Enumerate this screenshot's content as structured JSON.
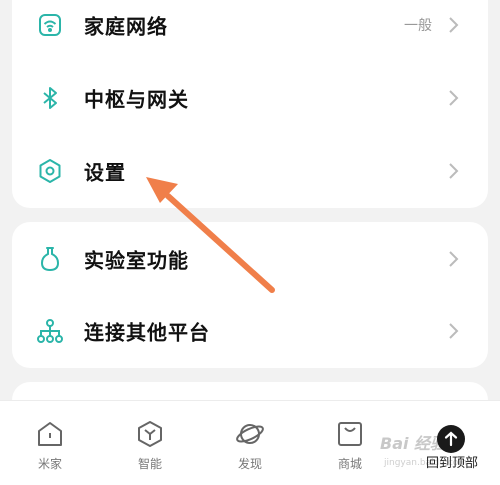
{
  "colors": {
    "accent": "#2bb5a9",
    "arrow": "#f07f4a",
    "background": "#f2f2f2",
    "card": "#ffffff"
  },
  "settings_group_1": {
    "items": [
      {
        "label": "家庭网络",
        "value": "一般",
        "icon": "wifi-router-icon"
      },
      {
        "label": "中枢与网关",
        "icon": "bluetooth-icon"
      },
      {
        "label": "设置",
        "icon": "hexagon-settings-icon"
      }
    ]
  },
  "settings_group_2": {
    "items": [
      {
        "label": "实验室功能",
        "icon": "flask-icon"
      },
      {
        "label": "连接其他平台",
        "icon": "network-hierarchy-icon"
      }
    ]
  },
  "tabbar": {
    "tabs": [
      {
        "label": "米家",
        "icon": "home-icon"
      },
      {
        "label": "智能",
        "icon": "smart-cube-icon"
      },
      {
        "label": "发现",
        "icon": "planet-icon"
      },
      {
        "label": "商城",
        "icon": "shopping-bag-icon"
      }
    ],
    "back_to_top_label": "回到顶部"
  },
  "watermark": {
    "text": "Bai 经验",
    "sub": "jingyan.baidu.com"
  }
}
